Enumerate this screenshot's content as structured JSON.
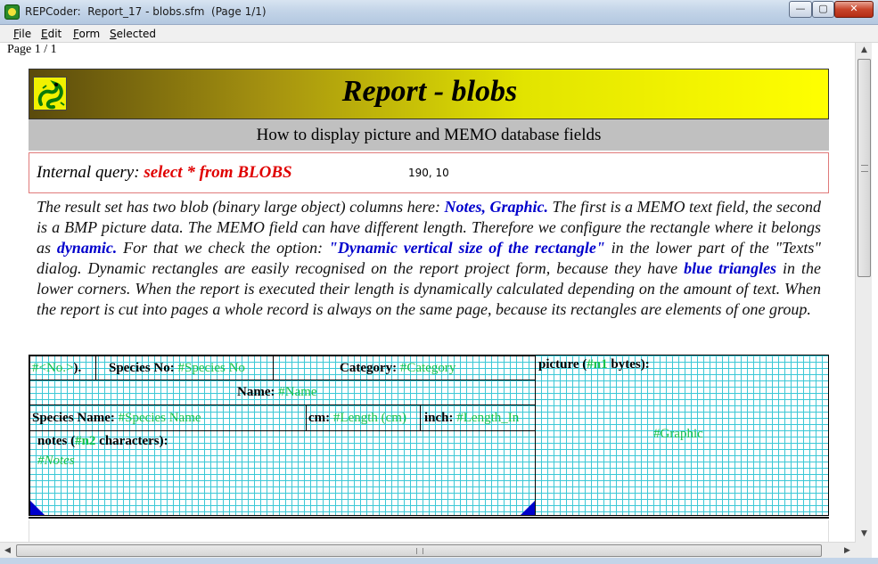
{
  "window": {
    "title": "REPCoder:  Report_17 - blobs.sfm  (Page 1/1)",
    "minimize_glyph": "—",
    "maximize_glyph": "▢",
    "close_glyph": "✕",
    "icon": "repcoder-dragon-icon"
  },
  "menu": {
    "file": "File",
    "edit": "Edit",
    "form": "Form",
    "selected": "Selected"
  },
  "page_indicator": "Page 1 / 1",
  "scrollbars": {
    "up": "▲",
    "down": "▼",
    "left": "◀",
    "right": "▶"
  },
  "report": {
    "title": "Report - blobs",
    "subtitle": "How to display picture and MEMO database fields",
    "query_label": "Internal query: ",
    "query_value": "select * from BLOBS",
    "query_coords": "190, 10",
    "description": {
      "p1": "The result set has two blob (binary large object) columns here: ",
      "h1": "Notes, Graphic.",
      "p2": " The first is a MEMO text field, the second is a BMP picture data. The MEMO field can have different length. Therefore we configure the rectangle where it belongs as ",
      "h2": "dynamic.",
      "p3": " For that we check the option: ",
      "h3": "\"Dynamic vertical size of the rectangle\"",
      "p4": " in the lower part of the \"Texts\" dialog. Dynamic rectangles are easily recognised on the report project form, because they have ",
      "h4": "blue triangles",
      "p5": " in the lower corners. When the report is executed their length is dynamically calculated depending on the amount of text. When the report is cut into pages a whole record is always on the same page, because its rectangles are elements of one group."
    },
    "record": {
      "no_field": "#<No.>",
      "no_suffix": ").",
      "species_no_label": "Species No: ",
      "species_no_field": "#Species No",
      "category_label": "Category: ",
      "category_field": "#Category",
      "name_label": "Name: ",
      "name_field": "#Name",
      "species_name_label": "Species Name: ",
      "species_name_field": "#Species Name",
      "cm_label": "cm: ",
      "cm_field": "#Length (cm)",
      "inch_label": "inch: ",
      "inch_field": "#Length_In",
      "notes_label_a": "notes (",
      "notes_count": "#n2",
      "notes_label_b": " characters):",
      "notes_field": "#Notes",
      "picture_label_a": "picture (",
      "picture_count": "#n1",
      "picture_label_b": " bytes):",
      "graphic_field": "#Graphic"
    }
  }
}
